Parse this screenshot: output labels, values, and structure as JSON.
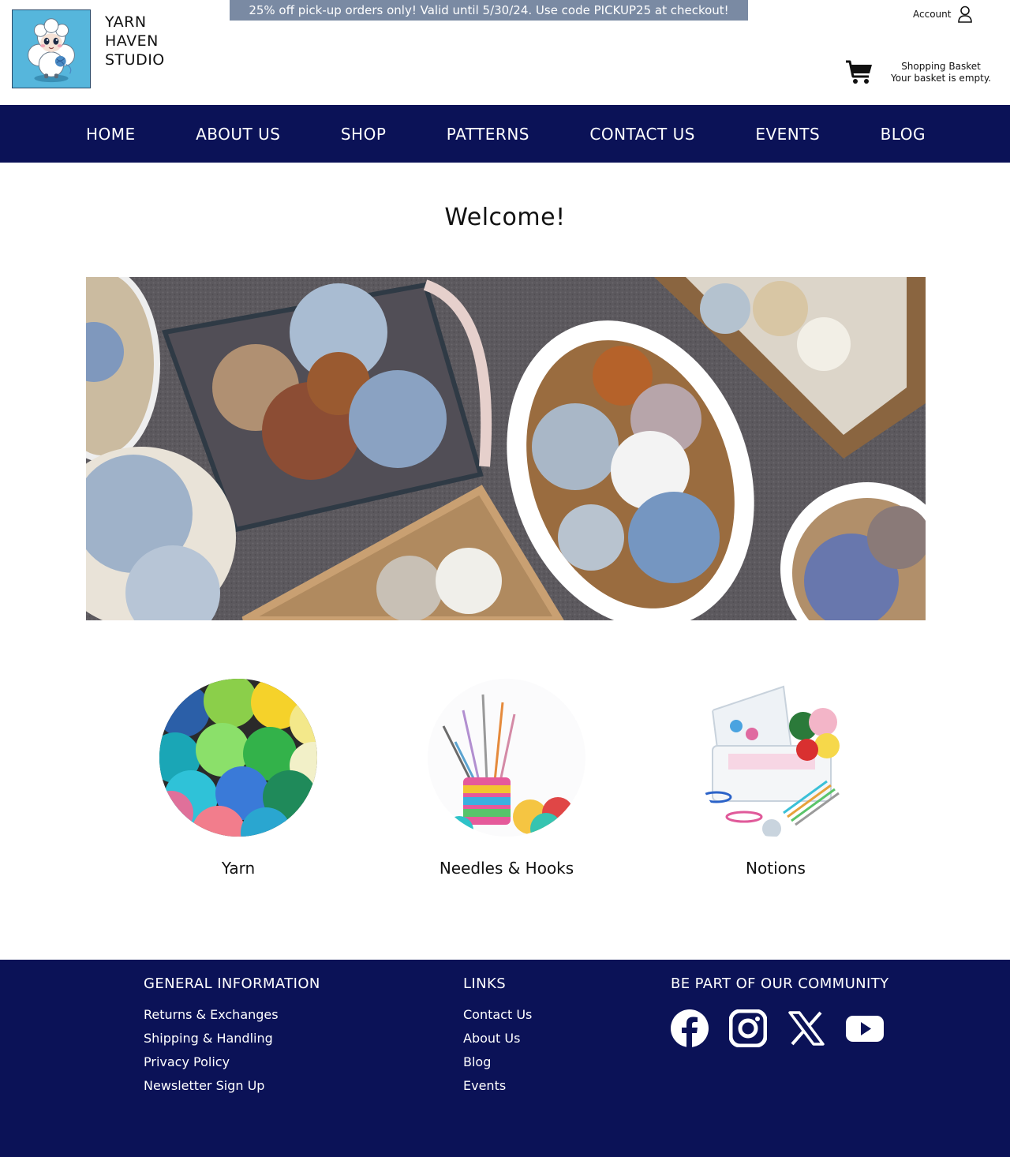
{
  "header": {
    "brand_lines": [
      "YARN",
      "HAVEN",
      "STUDIO"
    ],
    "promo": "25% off pick-up orders only! Valid until 5/30/24. Use code PICKUP25 at checkout!",
    "account_label": "Account",
    "basket_title": "Shopping Basket",
    "basket_status": "Your basket is empty."
  },
  "nav": {
    "items": [
      "HOME",
      "ABOUT US",
      "SHOP",
      "PATTERNS",
      "CONTACT US",
      "EVENTS",
      "BLOG"
    ]
  },
  "main": {
    "heading": "Welcome!",
    "categories": [
      {
        "label": "Yarn"
      },
      {
        "label": "Needles & Hooks"
      },
      {
        "label": "Notions"
      }
    ]
  },
  "footer": {
    "general": {
      "heading": "GENERAL INFORMATION",
      "links": [
        "Returns & Exchanges",
        "Shipping & Handling",
        "Privacy Policy",
        "Newsletter Sign Up"
      ]
    },
    "links": {
      "heading": "LINKS",
      "links": [
        "Contact Us",
        "About Us",
        "Blog",
        "Events"
      ]
    },
    "community": {
      "heading": "BE PART OF OUR COMMUNITY",
      "icons": [
        "facebook-icon",
        "instagram-icon",
        "x-icon",
        "youtube-icon"
      ]
    }
  },
  "colors": {
    "nav_bg": "#0b1257",
    "promo_bg": "#7a8aa3",
    "logo_bg": "#56b6dc"
  }
}
